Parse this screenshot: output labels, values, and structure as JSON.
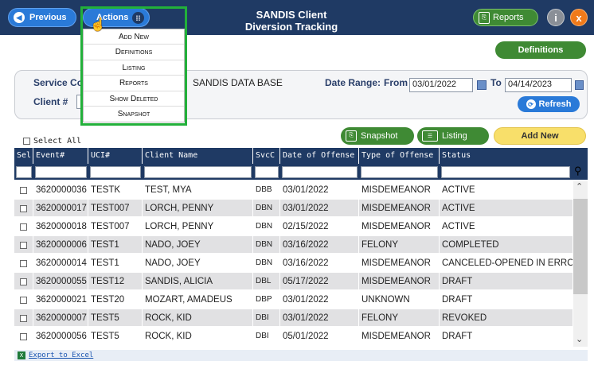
{
  "header": {
    "previous_label": "Previous",
    "actions_label": "Actions",
    "title_line1": "SANDIS Client",
    "title_line2": "Diversion Tracking",
    "reports_label": "Reports",
    "info_label": "i",
    "close_label": "x"
  },
  "actions_menu": {
    "items": [
      "Add New",
      "Definitions",
      "Listing",
      "Reports",
      "Show Deleted",
      "Snapshot"
    ]
  },
  "definitions_label": "Definitions",
  "filter": {
    "service_label": "Service Co",
    "service_value": "SANDIS DATA BASE",
    "client_label": "Client #",
    "date_range_label": "Date Range:",
    "from_label": "From",
    "from_value": "03/01/2022",
    "to_label": "To",
    "to_value": "04/14/2023",
    "refresh_label": "Refresh"
  },
  "toolbar": {
    "select_all_label": "Select All",
    "snapshot_label": "Snapshot",
    "listing_label": "Listing",
    "add_new_label": "Add New"
  },
  "table": {
    "columns": [
      "Sel",
      "Event#",
      "UCI#",
      "Client Name",
      "SvcC",
      "Date of Offense",
      "Type of Offense",
      "Status"
    ],
    "rows": [
      [
        "3620000036",
        "TESTK",
        "TEST, MYA",
        "DBB",
        "03/01/2022",
        "MISDEMEANOR",
        "ACTIVE"
      ],
      [
        "3620000017",
        "TEST007",
        "LORCH, PENNY",
        "DBN",
        "03/01/2022",
        "MISDEMEANOR",
        "ACTIVE"
      ],
      [
        "3620000018",
        "TEST007",
        "LORCH, PENNY",
        "DBN",
        "02/15/2022",
        "MISDEMEANOR",
        "ACTIVE"
      ],
      [
        "3620000006",
        "TEST1",
        "NADO, JOEY",
        "DBN",
        "03/16/2022",
        "FELONY",
        "COMPLETED"
      ],
      [
        "3620000014",
        "TEST1",
        "NADO, JOEY",
        "DBN",
        "03/16/2022",
        "MISDEMEANOR",
        "CANCELED-OPENED IN ERROR"
      ],
      [
        "3620000055",
        "TEST12",
        "SANDIS, ALICIA",
        "DBL",
        "05/17/2022",
        "MISDEMEANOR",
        "DRAFT"
      ],
      [
        "3620000021",
        "TEST20",
        "MOZART, AMADEUS",
        "DBP",
        "03/01/2022",
        "UNKNOWN",
        "DRAFT"
      ],
      [
        "3620000007",
        "TEST5",
        "ROCK, KID",
        "DBI",
        "03/01/2022",
        "FELONY",
        "REVOKED"
      ],
      [
        "3620000056",
        "TEST5",
        "ROCK, KID",
        "DBI",
        "05/01/2022",
        "MISDEMEANOR",
        "DRAFT"
      ]
    ]
  },
  "export_label": "Export to Excel"
}
